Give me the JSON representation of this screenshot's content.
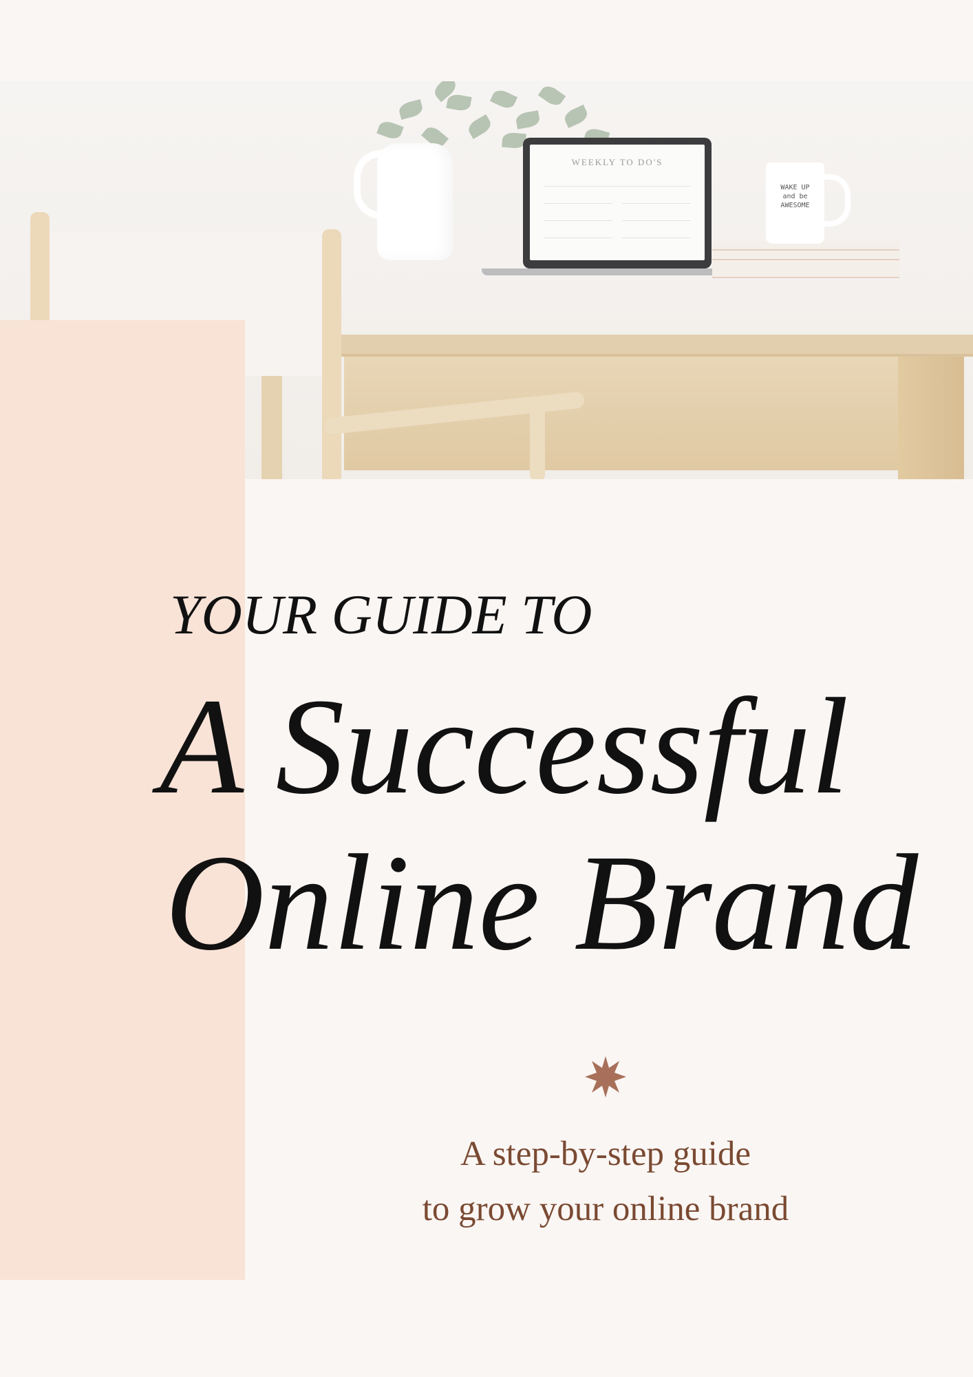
{
  "cover": {
    "kicker": "YOUR GUIDE TO",
    "title_line1": "A Successful",
    "title_line2": "Online Brand",
    "subtitle_line1": "A step-by-step guide",
    "subtitle_line2": "to grow your online brand"
  },
  "hero_photo": {
    "laptop_screen_text": "WEEKLY TO DO'S",
    "mug_text": "WAKE UP\nand be\nAWESOME"
  },
  "colors": {
    "background": "#faf6f4",
    "panel": "#f9e3d7",
    "title_text": "#111111",
    "accent": "#a8705a",
    "subtitle_text": "#7a4a32"
  },
  "icons": {
    "divider": "eight-point-star-icon"
  }
}
